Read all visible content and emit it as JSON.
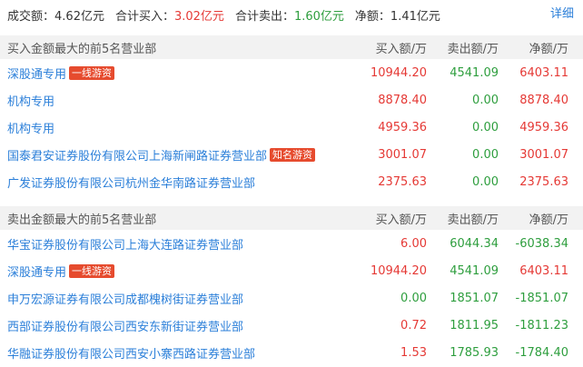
{
  "summary": {
    "turnover_label": "成交额：",
    "turnover_value": "4.62亿元",
    "buy_label": "合计买入：",
    "buy_value": "3.02亿元",
    "sell_label": "合计卖出：",
    "sell_value": "1.60亿元",
    "net_label": "净额：",
    "net_value": "1.41亿元",
    "detail_label": "详细"
  },
  "columns": {
    "buy": "买入额/万",
    "sell": "卖出额/万",
    "net": "净额/万"
  },
  "buy_section": {
    "title": "买入金额最大的前5名营业部",
    "rows": [
      {
        "name": "深股通专用",
        "tag": "一线游资",
        "buy": "10944.20",
        "sell": "4541.09",
        "net": "6403.11"
      },
      {
        "name": "机构专用",
        "tag": "",
        "buy": "8878.40",
        "sell": "0.00",
        "net": "8878.40"
      },
      {
        "name": "机构专用",
        "tag": "",
        "buy": "4959.36",
        "sell": "0.00",
        "net": "4959.36"
      },
      {
        "name": "国泰君安证券股份有限公司上海新闸路证券营业部",
        "tag": "知名游资",
        "buy": "3001.07",
        "sell": "0.00",
        "net": "3001.07"
      },
      {
        "name": "广发证券股份有限公司杭州金华南路证券营业部",
        "tag": "",
        "buy": "2375.63",
        "sell": "0.00",
        "net": "2375.63"
      }
    ]
  },
  "sell_section": {
    "title": "卖出金额最大的前5名营业部",
    "rows": [
      {
        "name": "华宝证券股份有限公司上海大连路证券营业部",
        "tag": "",
        "buy": "6.00",
        "sell": "6044.34",
        "net": "-6038.34"
      },
      {
        "name": "深股通专用",
        "tag": "一线游资",
        "buy": "10944.20",
        "sell": "4541.09",
        "net": "6403.11"
      },
      {
        "name": "申万宏源证券有限公司成都槐树街证券营业部",
        "tag": "",
        "buy": "0.00",
        "sell": "1851.07",
        "net": "-1851.07"
      },
      {
        "name": "西部证券股份有限公司西安东新街证券营业部",
        "tag": "",
        "buy": "0.72",
        "sell": "1811.95",
        "net": "-1811.23"
      },
      {
        "name": "华融证券股份有限公司西安小寨西路证券营业部",
        "tag": "",
        "buy": "1.53",
        "sell": "1785.93",
        "net": "-1784.40"
      }
    ]
  },
  "colors": {
    "up": "#e53935",
    "down": "#2e9e3e",
    "link": "#2b7fd9",
    "tag": "#e64b2e"
  }
}
